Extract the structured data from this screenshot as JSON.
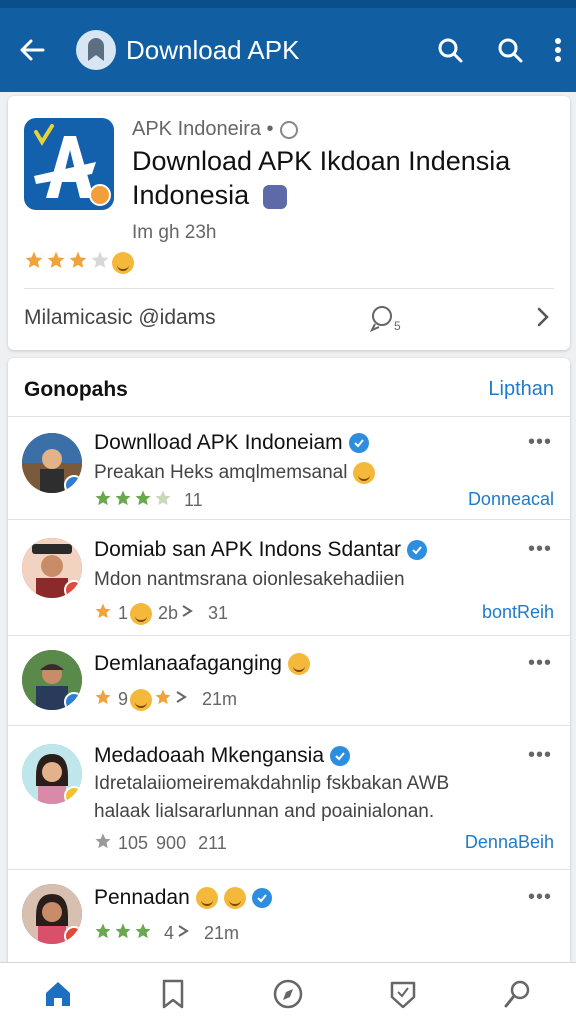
{
  "appbar": {
    "title": "Download APK",
    "back_icon": "arrow-left-icon",
    "search_icon": "search-icon",
    "menu_icon": "more-vertical-icon",
    "color": "#115ea3"
  },
  "app_card": {
    "meta": "APK Indoneira •",
    "name": "Download APK Ikdoan Indensia Indonesia",
    "time": "Im gh 23h",
    "rating": 3,
    "footer_label": "Milamicasic @idams",
    "footer_count": "5"
  },
  "list": {
    "header": "Gonopahs",
    "header_link": "Lipthan",
    "items": [
      {
        "name": "Downlload APK Indoneiam",
        "verified": true,
        "desc": "Preakan Heks amqlmemsanal",
        "stars": 3,
        "count": "11",
        "action": "Donneacal",
        "avatar_color": "#6a4a3a",
        "badge_color": "#2d7fd4"
      },
      {
        "name": "Domiab san APK Indons Sdantar",
        "verified": true,
        "desc": "Mdon nantmsrana oionlesakehadiien",
        "stars": 1,
        "count_a": "1",
        "count_b": "2b",
        "count": "31",
        "action": "bontReih",
        "avatar_color": "#c0392b",
        "badge_color": "#e04a3a"
      },
      {
        "name": "Demlanaafaganging",
        "verified": false,
        "desc": "",
        "stars": 1,
        "count_a": "9",
        "count": "21m",
        "action": "",
        "avatar_color": "#4a7a3a",
        "badge_color": "#2d7fd4"
      },
      {
        "name": "Medadoaah Mkengansia",
        "verified": true,
        "desc": "Idretalaiiomeiremakdahnlip fskbakan AWB halaak lialsararlunnan and poainialonan.",
        "stars": 1,
        "count_a": "105",
        "count_b": "900",
        "count": "211",
        "action": "DennaBeih",
        "avatar_color": "#6fb4c4",
        "badge_color": "#f2c12e"
      },
      {
        "name": "Pennadan",
        "verified": true,
        "desc": "",
        "stars": 3,
        "count_a": "4",
        "count": "21m",
        "action": "",
        "avatar_color": "#7a3b3b",
        "badge_color": "#e04a3a"
      }
    ]
  },
  "bottom_nav": [
    "home-icon",
    "bookmark-icon",
    "compass-icon",
    "shield-icon",
    "profile-search-icon"
  ]
}
